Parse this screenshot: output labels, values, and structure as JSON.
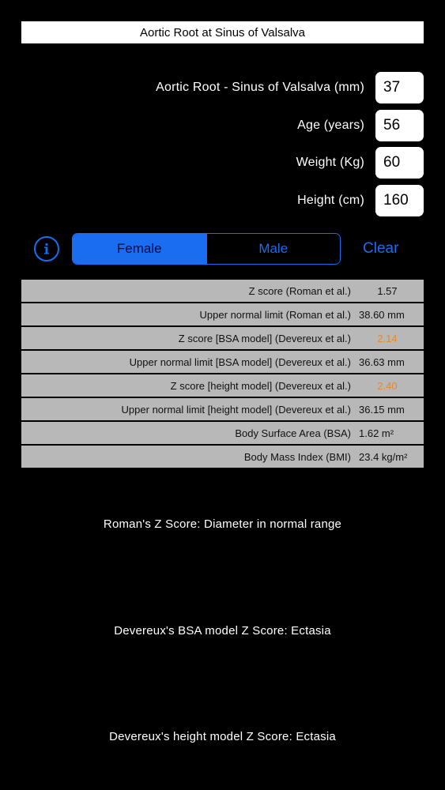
{
  "header": {
    "title": "Aortic Root at Sinus of Valsalva"
  },
  "inputs": [
    {
      "label": "Aortic Root - Sinus of Valsalva (mm)",
      "value": "37"
    },
    {
      "label": "Age (years)",
      "value": "56"
    },
    {
      "label": "Weight (Kg)",
      "value": "60"
    },
    {
      "label": "Height (cm)",
      "value": "160"
    }
  ],
  "controls": {
    "info_icon": "info-circle-icon",
    "gender_options": [
      "Female",
      "Male"
    ],
    "gender_selected": "Female",
    "clear_label": "Clear"
  },
  "results": [
    {
      "label": "Z score (Roman et al.)",
      "value": "1.57"
    },
    {
      "label": "Upper normal limit (Roman et al.)",
      "value": "38.60 mm"
    },
    {
      "label": "Z score [BSA model] (Devereux et al.)",
      "value": "2.14",
      "color": "#e8872a"
    },
    {
      "label": "Upper normal limit [BSA model] (Devereux et al.)",
      "value": "36.63 mm"
    },
    {
      "label": "Z score [height model] (Devereux et al.)",
      "value": "2.40",
      "color": "#e8872a"
    },
    {
      "label": "Upper normal limit [height model] (Devereux et al.)",
      "value": "36.15 mm"
    },
    {
      "label": "Body Surface Area (BSA)",
      "value": "1.62 m²"
    },
    {
      "label": "Body Mass Index (BMI)",
      "value": "23.4 kg/m²"
    }
  ],
  "interpretations": [
    "Roman's Z Score:  Diameter in normal range",
    "Devereux's BSA model Z Score:  Ectasia",
    "Devereux's height model Z Score:  Ectasia"
  ],
  "colors": {
    "accent": "#1a6cf0",
    "warning": "#e8872a",
    "row_background": "#b8b8b8",
    "background": "#000000"
  }
}
